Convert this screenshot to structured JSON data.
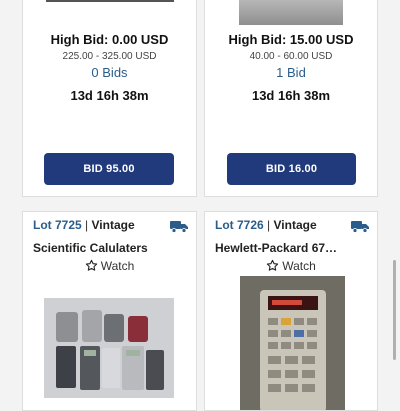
{
  "cards": [
    {
      "high_bid": "High Bid: 0.00 USD",
      "estimate": "225.00 - 325.00 USD",
      "bids": "0 Bids",
      "time_left": "13d 16h 38m",
      "bid_button": "BID 95.00"
    },
    {
      "high_bid": "High Bid: 15.00 USD",
      "estimate": "40.00 - 60.00 USD",
      "bids": "1 Bid",
      "time_left": "13d 16h 38m",
      "bid_button": "BID 16.00"
    },
    {
      "lot": "Lot 7725",
      "separator": "|",
      "category": "Vintage",
      "title": "Scientific Calulaters",
      "watch": "Watch",
      "icons": [
        "truck-icon",
        "star-outline-icon"
      ]
    },
    {
      "lot": "Lot 7726",
      "separator": "|",
      "category": "Vintage",
      "title": "Hewlett-Packard 67…",
      "watch": "Watch",
      "icons": [
        "truck-icon",
        "star-outline-icon"
      ]
    }
  ],
  "colors": {
    "accent": "#213a7c",
    "link": "#2b5d8a",
    "page_background": "#f3f3f3"
  }
}
